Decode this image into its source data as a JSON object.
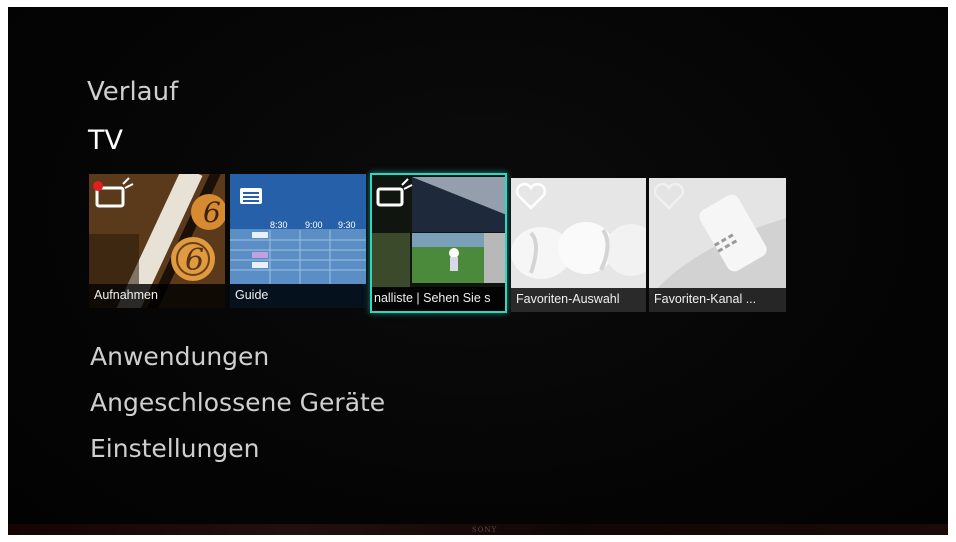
{
  "menu": {
    "history_heading": "Verlauf",
    "tv_heading": "TV",
    "items": [
      {
        "label": "Anwendungen"
      },
      {
        "label": "Angeschlossene Geräte"
      },
      {
        "label": "Einstellungen"
      }
    ]
  },
  "tiles": [
    {
      "label": "Aufnahmen",
      "icon": "tv-record-icon"
    },
    {
      "label": "Guide",
      "icon": "guide-icon",
      "times": [
        "8:30",
        "9:00",
        "9:30"
      ]
    },
    {
      "label": "nalliste | Sehen Sie s",
      "icon": "tv-channel-icon",
      "focused": true
    },
    {
      "label": "Favoriten-Auswahl",
      "icon": "heart-icon"
    },
    {
      "label": "Favoriten-Kanal ...",
      "icon": "heart-icon"
    }
  ],
  "bezel": {
    "brand": "SONY"
  },
  "colors": {
    "focus": "#2fd6c0",
    "background": "#050505",
    "text": "#cfcfcf"
  }
}
